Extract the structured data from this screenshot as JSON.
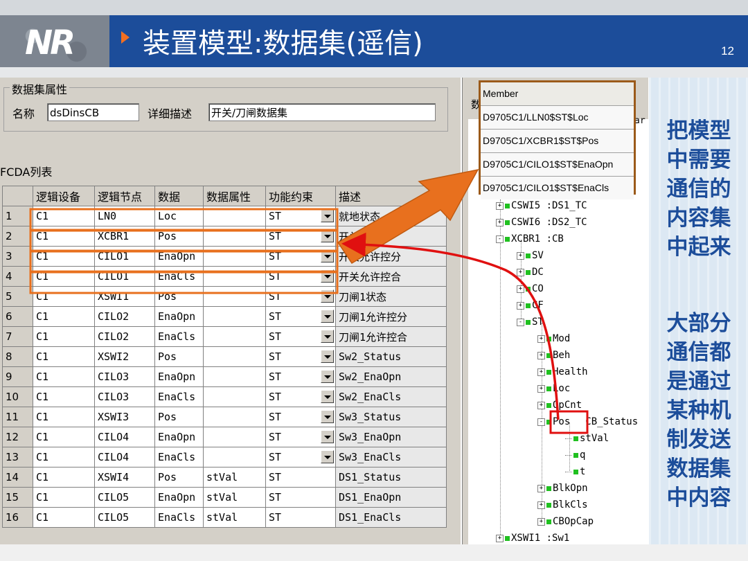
{
  "header": {
    "logo": "NR",
    "title": "装置模型:数据集(遥信)",
    "page_number": "12"
  },
  "dialog": {
    "group_title": "数据集属性",
    "name_label": "名称",
    "name_value": "dsDinsCB",
    "desc_label": "详细描述",
    "desc_value": "开关/刀闸数据集",
    "fcda_label": "FCDA列表"
  },
  "table": {
    "columns": [
      "",
      "逻辑设备",
      "逻辑节点",
      "数据",
      "数据属性",
      "功能约束",
      "描述"
    ],
    "rows": [
      [
        "1",
        "C1",
        "LN0",
        "Loc",
        "",
        "ST",
        "就地状态"
      ],
      [
        "2",
        "C1",
        "XCBR1",
        "Pos",
        "",
        "ST",
        "开关状态"
      ],
      [
        "3",
        "C1",
        "CILO1",
        "EnaOpn",
        "",
        "ST",
        "开关允许控分"
      ],
      [
        "4",
        "C1",
        "CILO1",
        "EnaCls",
        "",
        "ST",
        "开关允许控合"
      ],
      [
        "5",
        "C1",
        "XSWI1",
        "Pos",
        "",
        "ST",
        "刀闸1状态"
      ],
      [
        "6",
        "C1",
        "CILO2",
        "EnaOpn",
        "",
        "ST",
        "刀闸1允许控分"
      ],
      [
        "7",
        "C1",
        "CILO2",
        "EnaCls",
        "",
        "ST",
        "刀闸1允许控合"
      ],
      [
        "8",
        "C1",
        "XSWI2",
        "Pos",
        "",
        "ST",
        "Sw2_Status"
      ],
      [
        "9",
        "C1",
        "CILO3",
        "EnaOpn",
        "",
        "ST",
        "Sw2_EnaOpn"
      ],
      [
        "10",
        "C1",
        "CILO3",
        "EnaCls",
        "",
        "ST",
        "Sw2_EnaCls"
      ],
      [
        "11",
        "C1",
        "XSWI3",
        "Pos",
        "",
        "ST",
        "Sw3_Status"
      ],
      [
        "12",
        "C1",
        "CILO4",
        "EnaOpn",
        "",
        "ST",
        "Sw3_EnaOpn"
      ],
      [
        "13",
        "C1",
        "CILO4",
        "EnaCls",
        "",
        "ST",
        "Sw3_EnaCls"
      ],
      [
        "14",
        "C1",
        "XSWI4",
        "Pos",
        "stVal",
        "ST",
        "DS1_Status"
      ],
      [
        "15",
        "C1",
        "CILO5",
        "EnaOpn",
        "stVal",
        "ST",
        "DS1_EnaOpn"
      ],
      [
        "16",
        "C1",
        "CILO5",
        "EnaCls",
        "stVal",
        "ST",
        "DS1_EnaCls"
      ]
    ]
  },
  "member_list": {
    "header": "Member",
    "items": [
      "D9705C1/LLN0$ST$Loc",
      "D9705C1/XCBR1$ST$Pos",
      "D9705C1/CILO1$ST$EnaOpn",
      "D9705C1/CILO1$ST$EnaCls"
    ]
  },
  "tree": {
    "items": [
      "CSWI5 :DS1_TC",
      "CSWI6 :DS2_TC",
      "XCBR1 :CB",
      "SV",
      "DC",
      "CO",
      "CF",
      "ST",
      "Mod",
      "Beh",
      "Health",
      "Loc",
      "OpCnt",
      "Pos",
      "stVal",
      "q",
      "t",
      "BlkOpn",
      "BlkCls",
      "CBOpCap",
      "XSWI1 :Sw1"
    ],
    "pos_desc": "CB_Status",
    "partial_left": "数",
    "partial_right": "ar"
  },
  "notes": {
    "note1": [
      "把模型",
      "中需要",
      "通信的",
      "内容集",
      "中起来"
    ],
    "note2": [
      "大部分",
      "通信都",
      "是通过",
      "某种机",
      "制发送",
      "数据集",
      "中内容"
    ]
  },
  "colors": {
    "header_blue": "#1c4d9a",
    "highlight_orange": "#e8701e",
    "red_arrow": "#e01010",
    "accent": "#f26f21"
  }
}
